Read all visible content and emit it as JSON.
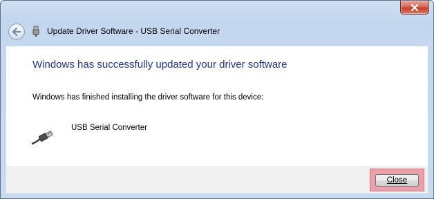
{
  "titlebar": {
    "close_icon": "close-x-icon"
  },
  "nav": {
    "back_icon": "back-arrow-icon",
    "wizard_icon": "usb-plug-icon",
    "title": "Update Driver Software - USB Serial Converter"
  },
  "main": {
    "heading": "Windows has successfully updated your driver software",
    "message": "Windows has finished installing the driver software for this device:",
    "device": {
      "icon": "usb-cable-icon",
      "name": "USB Serial Converter"
    }
  },
  "footer": {
    "close_label": "Close"
  },
  "colors": {
    "heading": "#1e3287",
    "highlight": "#e9a1ab",
    "titlebar_close": "#c0402b"
  }
}
